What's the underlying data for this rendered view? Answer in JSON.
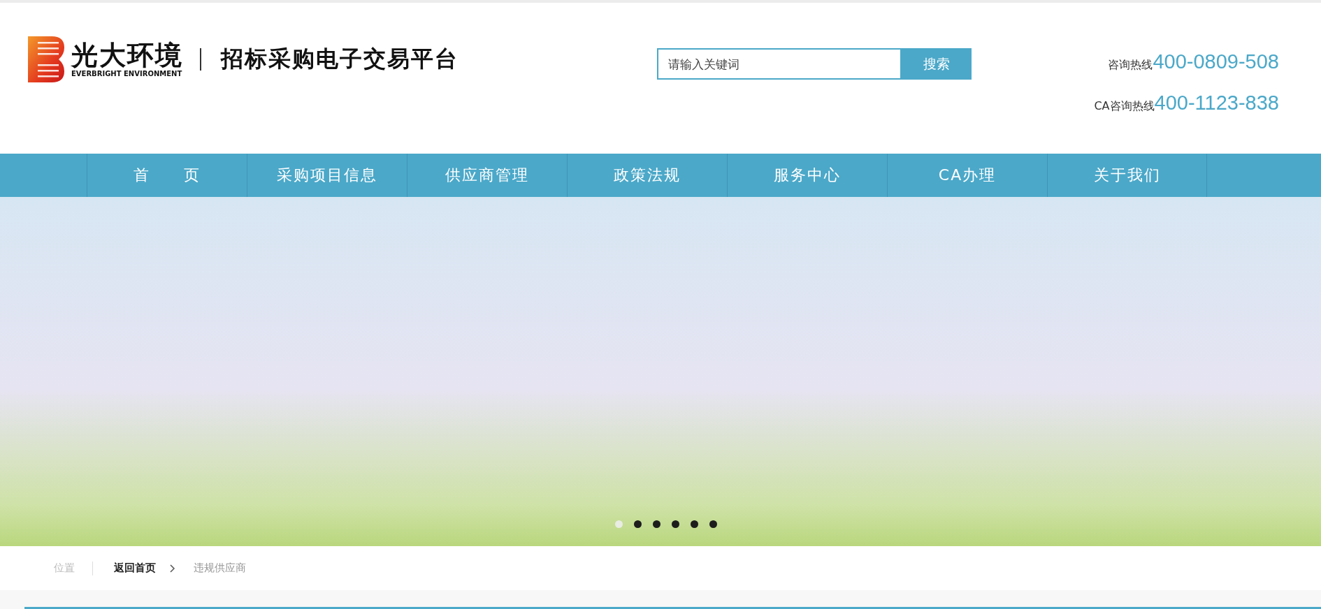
{
  "header": {
    "brand_name": "光大环境",
    "brand_subtitle": "EVERBRIGHT ENVIRONMENT",
    "platform_title": "招标采购电子交易平台"
  },
  "search": {
    "placeholder": "请输入关键词",
    "button": "搜索"
  },
  "hotlines": [
    {
      "label": "咨询热线",
      "number": "400-0809-508"
    },
    {
      "label": "CA咨询热线",
      "number": "400-1123-838"
    }
  ],
  "nav": [
    "首　　页",
    "采购项目信息",
    "供应商管理",
    "政策法规",
    "服务中心",
    "CA办理",
    "关于我们"
  ],
  "banner": {
    "slides": [
      {
        "selected": true
      },
      {
        "selected": false
      },
      {
        "selected": false
      },
      {
        "selected": false
      },
      {
        "selected": false
      },
      {
        "selected": false
      }
    ]
  },
  "breadcrumb": {
    "label": "位置",
    "items": [
      "返回首页",
      "违规供应商"
    ]
  }
}
